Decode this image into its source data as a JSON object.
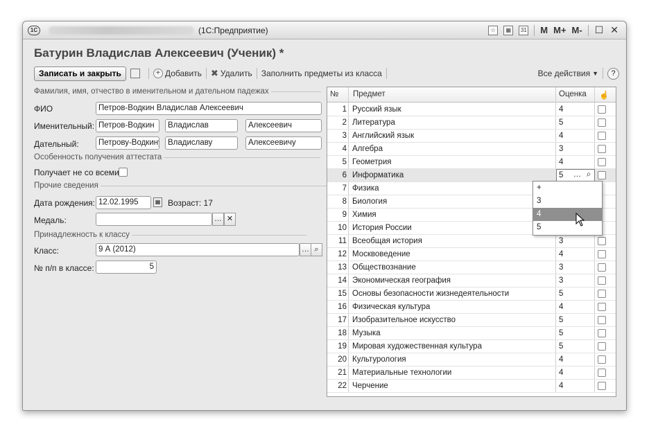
{
  "window": {
    "title": "(1С:Предприятие)",
    "logo": "1С",
    "toolbar_letters": [
      "M",
      "M+",
      "M-"
    ]
  },
  "form": {
    "heading": "Батурин Владислав Алексеевич (Ученик) *",
    "toolbar": {
      "save_close": "Записать и закрыть",
      "add": "Добавить",
      "delete": "Удалить",
      "fill_subjects": "Заполнить предметы из класса",
      "all_actions": "Все действия",
      "help": "?"
    },
    "group_fio": "Фамилия, имя, отчество в именительном и дательном падежах",
    "fio_label": "ФИО",
    "fio_value": "Петров-Водкин Владислав Алексеевич",
    "nominative_label": "Именительный:",
    "nominative": [
      "Петров-Водкин",
      "Владислав",
      "Алексеевич"
    ],
    "dative_label": "Дательный:",
    "dative": [
      "Петрову-Водкину",
      "Владиславу",
      "Алексеевичу"
    ],
    "group_attestat": "Особенность получения аттестата",
    "not_from_all_label": "Получает не со всеми:",
    "group_other": "Прочие сведения",
    "birth_label": "Дата рождения:",
    "birth_value": "12.02.1995",
    "age_text": "Возраст: 17",
    "medal_label": "Медаль:",
    "medal_value": "",
    "group_class": "Принадлежность к классу",
    "class_label": "Класс:",
    "class_value": "9 А (2012)",
    "num_label": "№ п/п в классе:",
    "num_value": "5"
  },
  "grades_table": {
    "headers": {
      "num": "№",
      "subject": "Предмет",
      "grade": "Оценка",
      "mark": "☝"
    },
    "rows": [
      {
        "n": "1",
        "subject": "Русский язык",
        "grade": "4"
      },
      {
        "n": "2",
        "subject": "Литература",
        "grade": "5"
      },
      {
        "n": "3",
        "subject": "Английский язык",
        "grade": "4"
      },
      {
        "n": "4",
        "subject": "Алгебра",
        "grade": "3"
      },
      {
        "n": "5",
        "subject": "Геометрия",
        "grade": "4"
      },
      {
        "n": "6",
        "subject": "Информатика",
        "grade": "5"
      },
      {
        "n": "7",
        "subject": "Физика",
        "grade": ""
      },
      {
        "n": "8",
        "subject": "Биология",
        "grade": ""
      },
      {
        "n": "9",
        "subject": "Химия",
        "grade": ""
      },
      {
        "n": "10",
        "subject": "История России",
        "grade": ""
      },
      {
        "n": "11",
        "subject": "Всеобщая история",
        "grade": "3"
      },
      {
        "n": "12",
        "subject": "Москвоведение",
        "grade": "4"
      },
      {
        "n": "13",
        "subject": "Обществознание",
        "grade": "3"
      },
      {
        "n": "14",
        "subject": "Экономическая география",
        "grade": "3"
      },
      {
        "n": "15",
        "subject": "Основы безопасности жизнедеятельности",
        "grade": "5"
      },
      {
        "n": "16",
        "subject": "Физическая культура",
        "grade": "4"
      },
      {
        "n": "17",
        "subject": "Изобразительное искусство",
        "grade": "5"
      },
      {
        "n": "18",
        "subject": "Музыка",
        "grade": "5"
      },
      {
        "n": "19",
        "subject": "Мировая художественная культура",
        "grade": "5"
      },
      {
        "n": "20",
        "subject": "Культурология",
        "grade": "4"
      },
      {
        "n": "21",
        "subject": "Материальные технологии",
        "grade": "4"
      },
      {
        "n": "22",
        "subject": "Черчение",
        "grade": "4"
      }
    ],
    "dropdown_options": [
      "+",
      "3",
      "4",
      "5"
    ],
    "dropdown_highlighted": "4"
  }
}
